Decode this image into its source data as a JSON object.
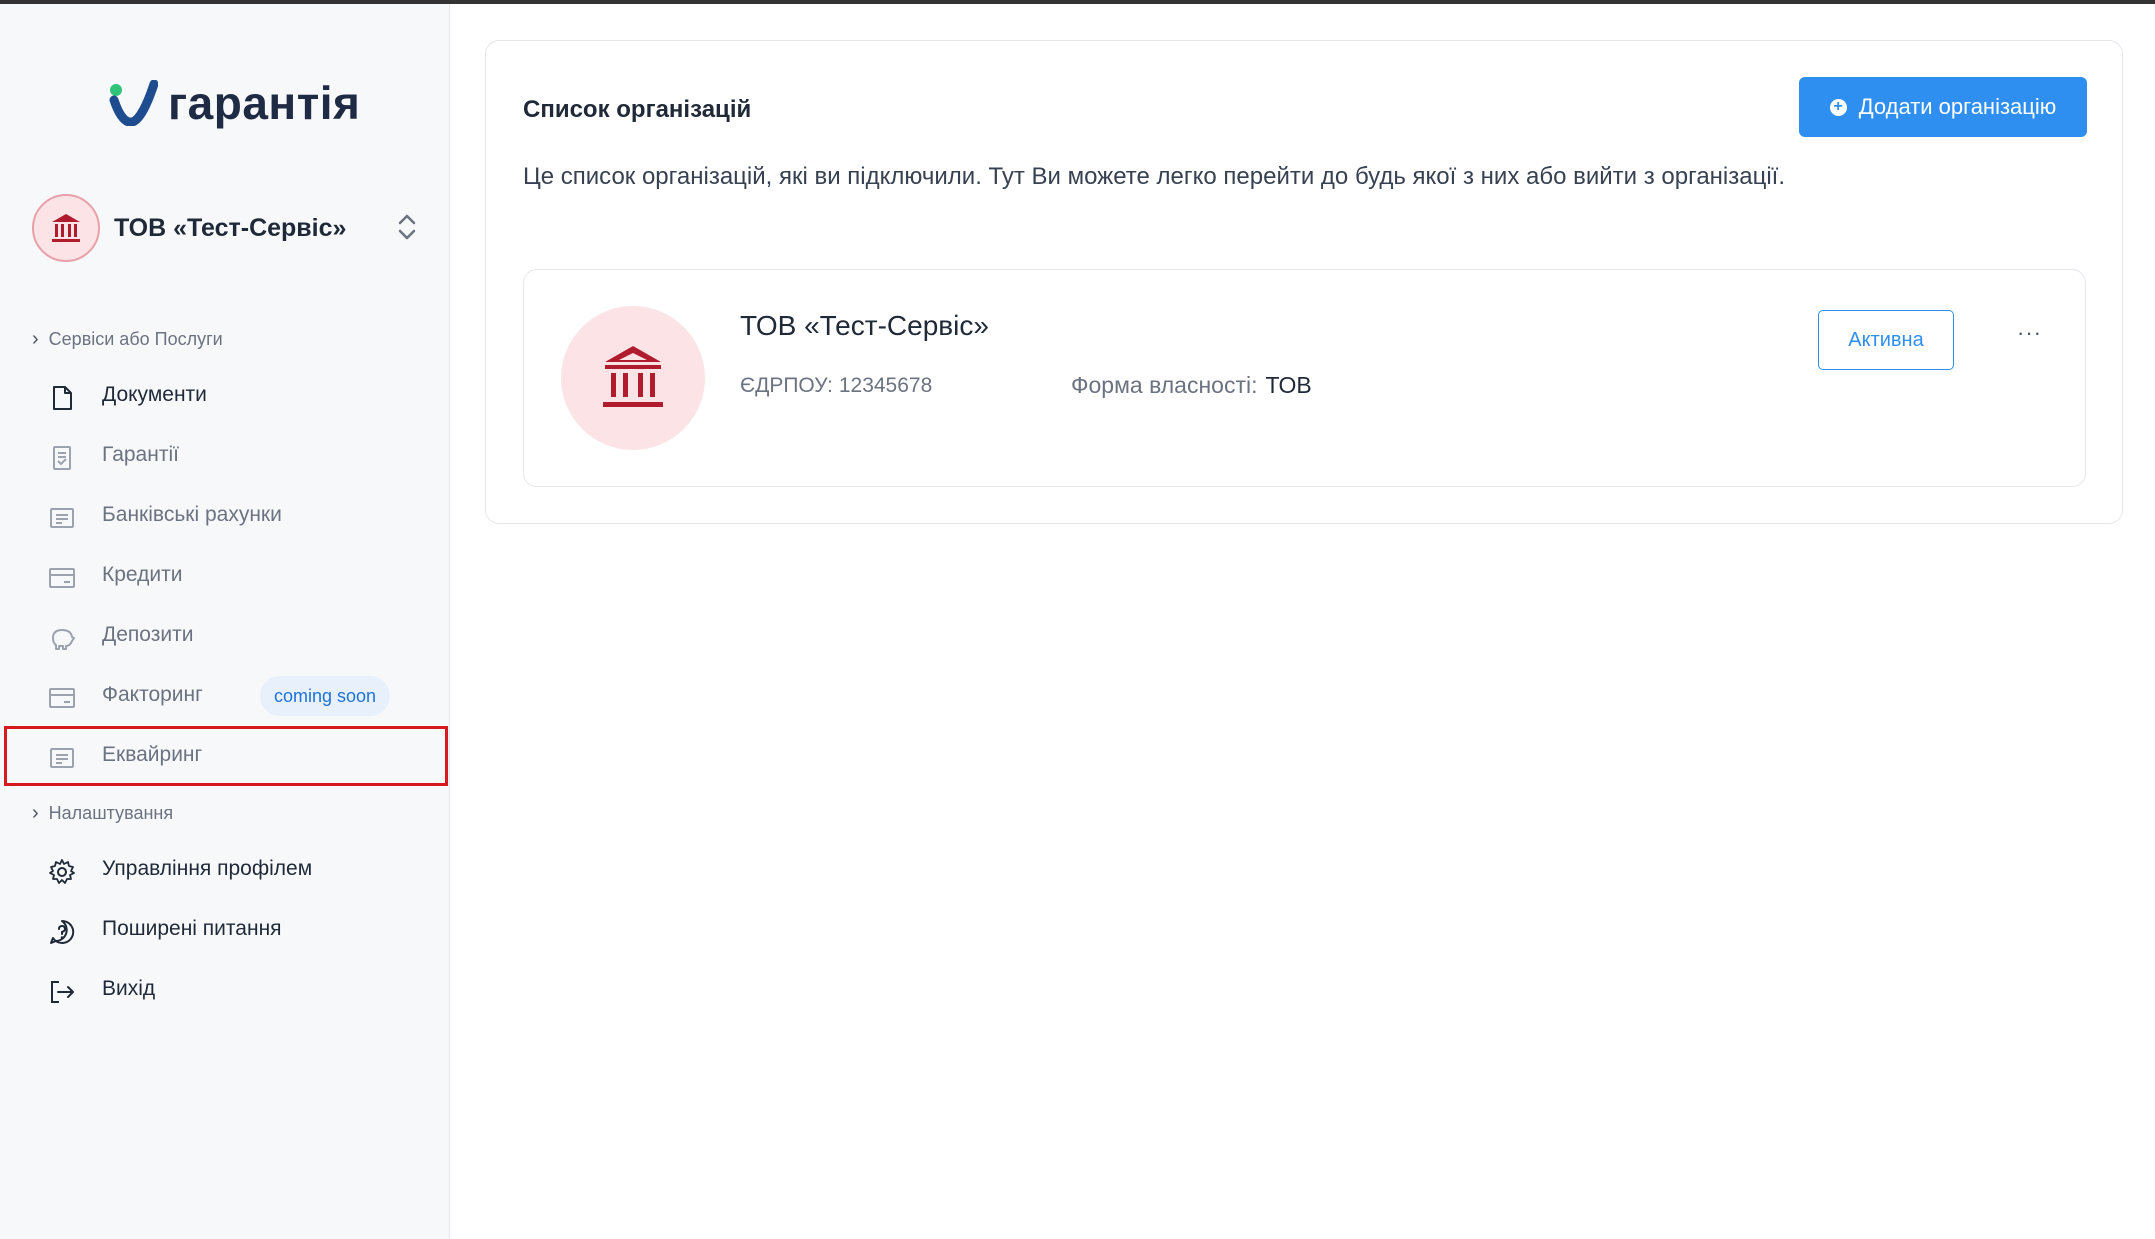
{
  "brand": {
    "logo_text": "гарантія",
    "accent": "#2f8ff0",
    "logo_blue": "#1f4b8f",
    "logo_green": "#2fc47a"
  },
  "org_switcher": {
    "name": "ТОВ «Тест-Сервіс»",
    "icon": "bank-icon"
  },
  "sidebar": {
    "sections": [
      {
        "label": "Сервіси або Послуги"
      },
      {
        "label": "Налаштування"
      }
    ],
    "items": [
      {
        "label": "Документи",
        "icon": "document-icon"
      },
      {
        "label": "Гарантії",
        "icon": "guarantee-icon"
      },
      {
        "label": "Банківські рахунки",
        "icon": "bank-account-icon"
      },
      {
        "label": "Кредити",
        "icon": "credit-card-icon"
      },
      {
        "label": "Депозити",
        "icon": "piggy-bank-icon"
      },
      {
        "label": "Факторинг",
        "icon": "factoring-icon",
        "badge": "coming soon"
      },
      {
        "label": "Еквайринг",
        "icon": "acquiring-icon"
      }
    ],
    "settings_items": [
      {
        "label": "Управління профілем",
        "icon": "gear-icon"
      },
      {
        "label": "Поширені питання",
        "icon": "question-icon"
      },
      {
        "label": "Вихід",
        "icon": "logout-icon"
      }
    ]
  },
  "main": {
    "title": "Список організацій",
    "add_button": "Додати організацію",
    "description": "Це список організацій, які ви підключили. Тут Ви можете легко перейти до будь якої з них або вийти з організації.",
    "organizations": [
      {
        "name": "ТОВ «Тест-Сервіс»",
        "edrpou": "ЄДРПОУ: 12345678",
        "forma_label": "Форма власності:",
        "forma_value": "ТОВ",
        "status": "Активна",
        "more": "···"
      }
    ]
  }
}
